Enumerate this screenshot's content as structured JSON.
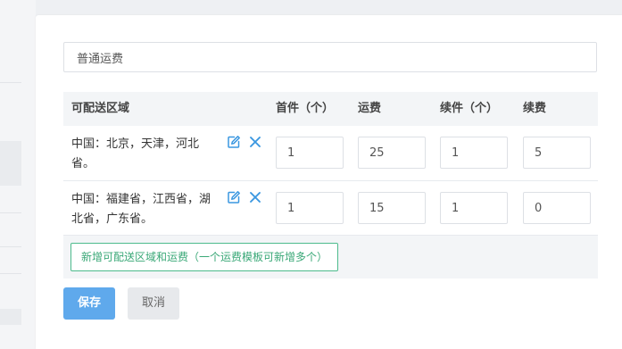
{
  "form": {
    "template_name_value": "普通运费",
    "template_name_placeholder": "普通运费"
  },
  "table": {
    "headers": {
      "region": "可配送区域",
      "first_qty": "首件（个）",
      "first_fee": "运费",
      "extra_qty": "续件（个）",
      "extra_fee": "续费"
    },
    "rows": [
      {
        "region": "中国：北京，天津，河北省。",
        "first_qty": "1",
        "first_fee": "25",
        "extra_qty": "1",
        "extra_fee": "5"
      },
      {
        "region": "中国：福建省，江西省，湖北省，广东省。",
        "first_qty": "1",
        "first_fee": "15",
        "extra_qty": "1",
        "extra_fee": "0"
      }
    ],
    "add_button_label": "新增可配送区域和运费（一个运费模板可新增多个）"
  },
  "actions": {
    "save_label": "保存",
    "cancel_label": "取消"
  },
  "colors": {
    "primary": "#5fa9ec",
    "icon_blue": "#3a97e0",
    "green": "#3aa877"
  },
  "icons": {
    "edit": "edit-icon",
    "delete": "close-icon"
  }
}
